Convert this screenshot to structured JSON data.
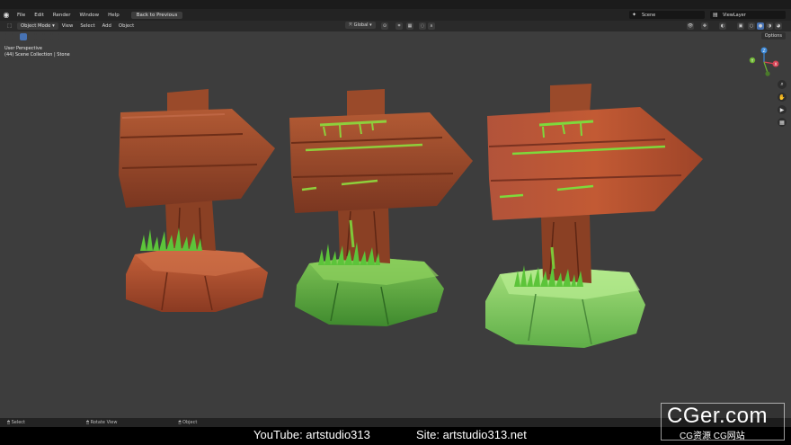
{
  "menu": {
    "items": [
      "File",
      "Edit",
      "Render",
      "Window",
      "Help"
    ],
    "back_button": "Back to Previous"
  },
  "scene": {
    "name": "Scene",
    "view_layer": "ViewLayer"
  },
  "header": {
    "mode": "Object Mode",
    "items": [
      "View",
      "Select",
      "Add",
      "Object"
    ],
    "orientation": "Global",
    "options": "Options"
  },
  "viewport": {
    "perspective": "User Perspective",
    "collection": "(44) Scene Collection | Stone"
  },
  "gizmo": {
    "x": "X",
    "y": "Y",
    "z": "Z"
  },
  "status": {
    "select": "Select",
    "rotate": "Rotate View",
    "object": "Object"
  },
  "footer": {
    "youtube": "YouTube: artstudio313",
    "site": "Site: artstudio313.net"
  },
  "watermark": {
    "brand": "CGer.com",
    "sub": "CG资源  CG网站"
  },
  "colors": {
    "wood": "#9a4a2a",
    "wood_dark": "#6e3018",
    "moss": "#7ec83a",
    "grass": "#5cc43a",
    "rock_brown": "#a8482a",
    "rock_green": "#6cb64a",
    "viewport_bg": "#3d3d3d"
  }
}
